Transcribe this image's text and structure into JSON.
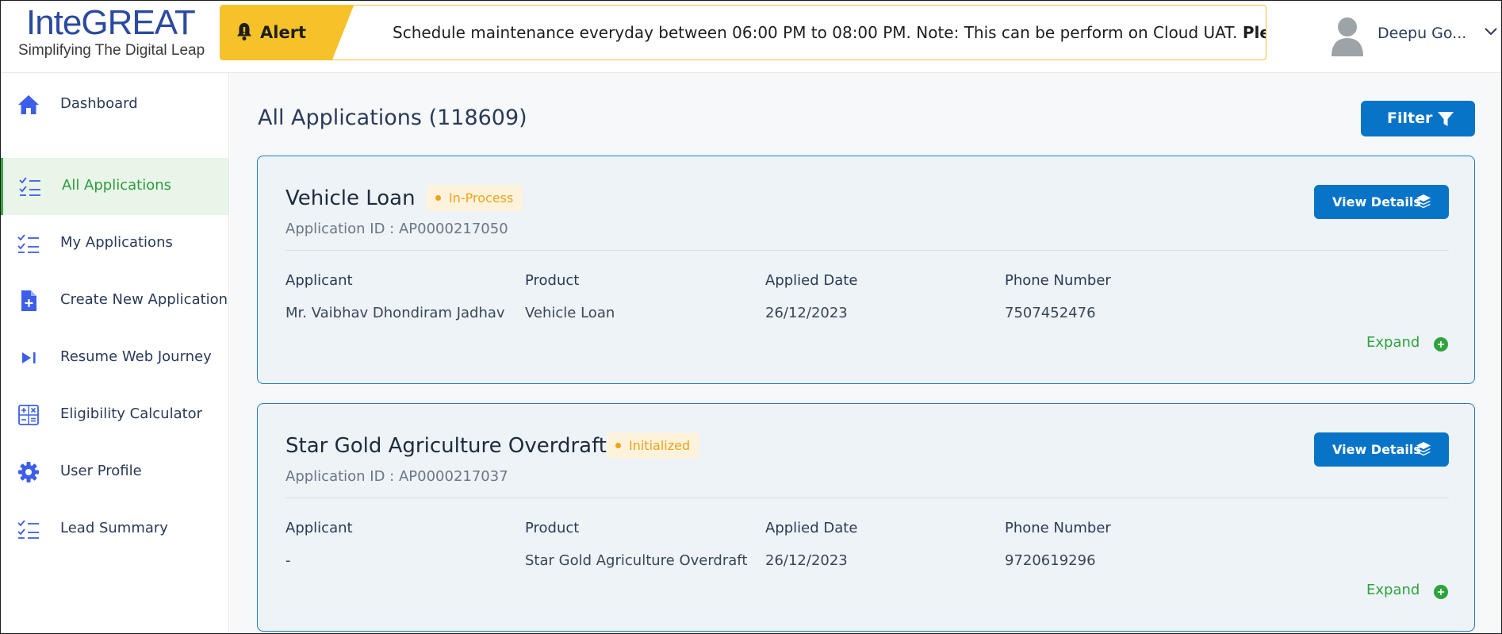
{
  "header": {
    "logo": {
      "part1": "Inte",
      "part2": "GREAT",
      "tagline": "Simplifying The Digital Leap"
    },
    "alert": {
      "label": "Alert",
      "icon": "bell-icon",
      "message": "Schedule maintenance everyday between 06:00 PM to 08:00 PM. Note: This can be perform on Cloud UAT.",
      "message_bold": "Plea"
    },
    "user": {
      "name": "Deepu Go...",
      "avatar_icon": "user-avatar-icon",
      "menu_icon": "chevron-down-icon"
    }
  },
  "sidebar": {
    "items": [
      {
        "label": "Dashboard",
        "icon": "home-icon",
        "active": false
      },
      {
        "label": "All Applications",
        "icon": "checklist-icon",
        "active": true
      },
      {
        "label": "My Applications",
        "icon": "checklist-icon",
        "active": false
      },
      {
        "label": "Create New Application",
        "icon": "file-add-icon",
        "active": false
      },
      {
        "label": "Resume Web Journey",
        "icon": "skip-forward-icon",
        "active": false
      },
      {
        "label": "Eligibility Calculator",
        "icon": "calculator-icon",
        "active": false
      },
      {
        "label": "User Profile",
        "icon": "gear-icon",
        "active": false
      },
      {
        "label": "Lead Summary",
        "icon": "checklist-icon",
        "active": false
      }
    ]
  },
  "main": {
    "title": "All Applications (118609)",
    "filter_label": "Filter",
    "columns": [
      "Applicant",
      "Product",
      "Applied Date",
      "Phone Number"
    ],
    "applications": [
      {
        "title": "Vehicle Loan",
        "status": "In-Process",
        "application_id": "Application ID : AP0000217050",
        "view_label": "View Details",
        "applicant": "Mr. Vaibhav Dhondiram Jadhav",
        "product": "Vehicle Loan",
        "applied_date": "26/12/2023",
        "phone": "7507452476",
        "expand_label": "Expand"
      },
      {
        "title": "Star Gold Agriculture Overdraft",
        "status": "Initialized",
        "application_id": "Application ID : AP0000217037",
        "view_label": "View Details",
        "applicant": "-",
        "product": "Star Gold Agriculture Overdraft",
        "applied_date": "26/12/2023",
        "phone": "9720619296",
        "expand_label": "Expand"
      }
    ]
  },
  "colors": {
    "primary": "#0874c8",
    "active_green": "#2d9a3c",
    "status_orange": "#f0a21a",
    "alert_yellow": "#f6c129",
    "nav_icon_blue": "#3d5ee8"
  }
}
